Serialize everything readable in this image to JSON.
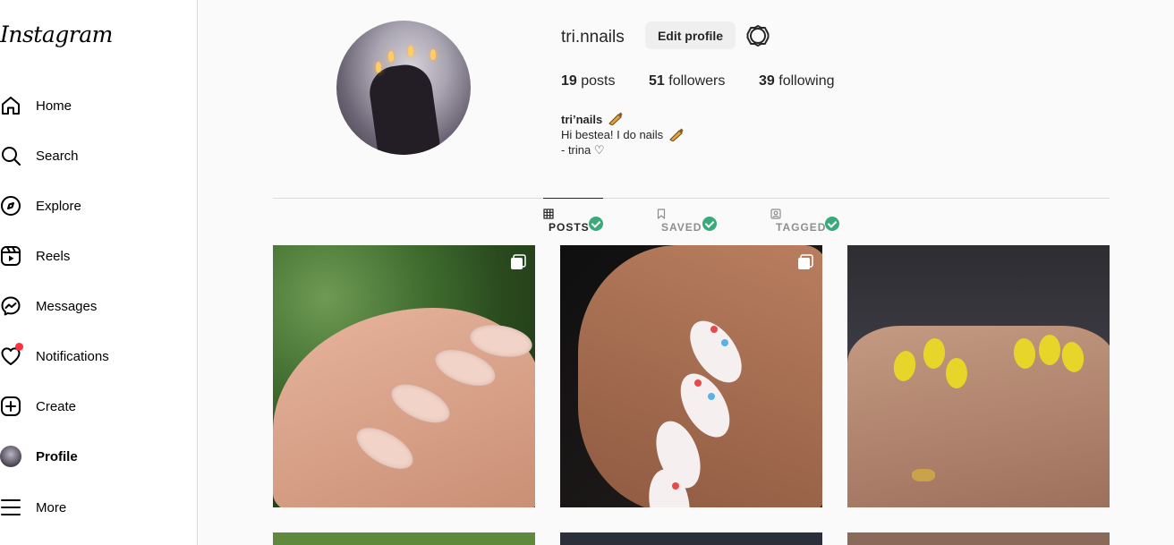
{
  "app": {
    "logo_text": "Instagram"
  },
  "sidebar": {
    "items": [
      {
        "label": "Home",
        "icon": "home-icon"
      },
      {
        "label": "Search",
        "icon": "search-icon"
      },
      {
        "label": "Explore",
        "icon": "compass-icon"
      },
      {
        "label": "Reels",
        "icon": "reels-icon"
      },
      {
        "label": "Messages",
        "icon": "messenger-icon"
      },
      {
        "label": "Notifications",
        "icon": "heart-icon",
        "has_badge": true
      },
      {
        "label": "Create",
        "icon": "plus-square-icon"
      },
      {
        "label": "Profile",
        "icon": "avatar",
        "active": true
      },
      {
        "label": "More",
        "icon": "hamburger-icon"
      }
    ]
  },
  "profile": {
    "username": "tri.nnails",
    "edit_label": "Edit profile",
    "posts_count": "19",
    "posts_label": "posts",
    "followers_count": "51",
    "followers_label": "followers",
    "following_count": "39",
    "following_label": "following",
    "display_name": "tri’nails",
    "bio_line1": "Hi bestea! I do nails",
    "bio_line2": "- trina ♡"
  },
  "tabs": [
    {
      "label": "POSTS",
      "active": true,
      "icon": "grid-icon"
    },
    {
      "label": "SAVED",
      "active": false,
      "icon": "bookmark-icon"
    },
    {
      "label": "TAGGED",
      "active": false,
      "icon": "tagged-icon"
    }
  ],
  "colors": {
    "accent_check": "#3aaa7a",
    "notification_dot": "#ff3040",
    "nail_polish_icon": "#e0a33a"
  }
}
